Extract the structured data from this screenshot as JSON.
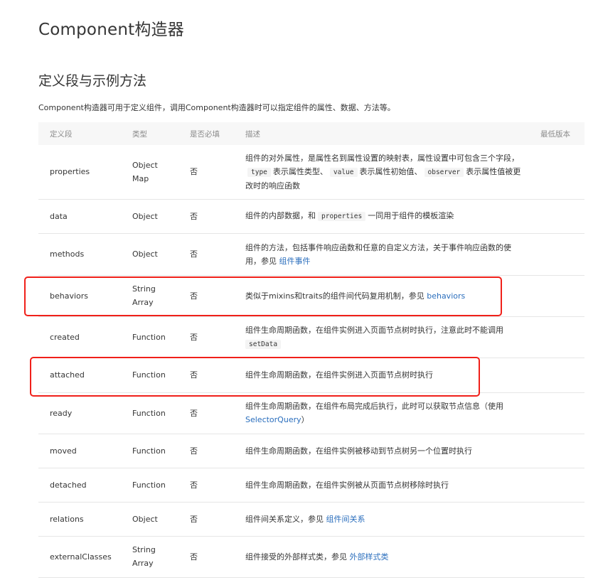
{
  "page_title": "Component构造器",
  "section_title": "定义段与示例方法",
  "intro": "Component构造器可用于定义组件，调用Component构造器时可以指定组件的属性、数据、方法等。",
  "table": {
    "headers": [
      "定义段",
      "类型",
      "是否必填",
      "描述",
      "最低版本"
    ],
    "rows": [
      {
        "name": "properties",
        "type": "Object Map",
        "required": "否",
        "d1": "组件的对外属性，是属性名到属性设置的映射表，属性设置中可包含三个字段，",
        "c1": "type",
        "d2": "表示属性类型、",
        "c2": "value",
        "d3": "表示属性初始值、",
        "c3": "observer",
        "d4": "表示属性值被更改时的响应函数"
      },
      {
        "name": "data",
        "type": "Object",
        "required": "否",
        "d1": "组件的内部数据，和",
        "c1": "properties",
        "d2": "一同用于组件的模板渲染"
      },
      {
        "name": "methods",
        "type": "Object",
        "required": "否",
        "d1": "组件的方法，包括事件响应函数和任意的自定义方法，关于事件响应函数的使用，参见",
        "link": "组件事件"
      },
      {
        "name": "behaviors",
        "type": "String Array",
        "required": "否",
        "d1": "类似于mixins和traits的组件间代码复用机制，参见",
        "link": "behaviors"
      },
      {
        "name": "created",
        "type": "Function",
        "required": "否",
        "d1": "组件生命周期函数，在组件实例进入页面节点树时执行，注意此时不能调用",
        "c1": "setData"
      },
      {
        "name": "attached",
        "type": "Function",
        "required": "否",
        "d1": "组件生命周期函数，在组件实例进入页面节点树时执行"
      },
      {
        "name": "ready",
        "type": "Function",
        "required": "否",
        "d1": "组件生命周期函数，在组件布局完成后执行，此时可以获取节点信息（使用",
        "link": "SelectorQuery",
        "d2": "）"
      },
      {
        "name": "moved",
        "type": "Function",
        "required": "否",
        "d1": "组件生命周期函数，在组件实例被移动到节点树另一个位置时执行"
      },
      {
        "name": "detached",
        "type": "Function",
        "required": "否",
        "d1": "组件生命周期函数，在组件实例被从页面节点树移除时执行"
      },
      {
        "name": "relations",
        "type": "Object",
        "required": "否",
        "d1": "组件间关系定义，参见",
        "link": "组件间关系"
      },
      {
        "name": "externalClasses",
        "type": "String Array",
        "required": "否",
        "d1": "组件接受的外部样式类，参见",
        "link": "外部样式类"
      }
    ]
  },
  "colors": {
    "highlight": "#f0201a",
    "link": "#2a6ebd"
  }
}
